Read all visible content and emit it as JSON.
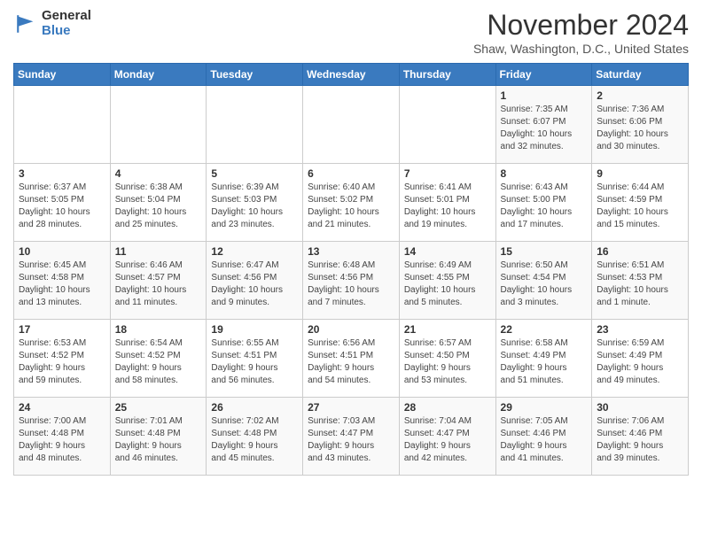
{
  "logo": {
    "general": "General",
    "blue": "Blue"
  },
  "header": {
    "month": "November 2024",
    "location": "Shaw, Washington, D.C., United States"
  },
  "days_of_week": [
    "Sunday",
    "Monday",
    "Tuesday",
    "Wednesday",
    "Thursday",
    "Friday",
    "Saturday"
  ],
  "weeks": [
    [
      {
        "day": "",
        "info": ""
      },
      {
        "day": "",
        "info": ""
      },
      {
        "day": "",
        "info": ""
      },
      {
        "day": "",
        "info": ""
      },
      {
        "day": "",
        "info": ""
      },
      {
        "day": "1",
        "info": "Sunrise: 7:35 AM\nSunset: 6:07 PM\nDaylight: 10 hours\nand 32 minutes."
      },
      {
        "day": "2",
        "info": "Sunrise: 7:36 AM\nSunset: 6:06 PM\nDaylight: 10 hours\nand 30 minutes."
      }
    ],
    [
      {
        "day": "3",
        "info": "Sunrise: 6:37 AM\nSunset: 5:05 PM\nDaylight: 10 hours\nand 28 minutes."
      },
      {
        "day": "4",
        "info": "Sunrise: 6:38 AM\nSunset: 5:04 PM\nDaylight: 10 hours\nand 25 minutes."
      },
      {
        "day": "5",
        "info": "Sunrise: 6:39 AM\nSunset: 5:03 PM\nDaylight: 10 hours\nand 23 minutes."
      },
      {
        "day": "6",
        "info": "Sunrise: 6:40 AM\nSunset: 5:02 PM\nDaylight: 10 hours\nand 21 minutes."
      },
      {
        "day": "7",
        "info": "Sunrise: 6:41 AM\nSunset: 5:01 PM\nDaylight: 10 hours\nand 19 minutes."
      },
      {
        "day": "8",
        "info": "Sunrise: 6:43 AM\nSunset: 5:00 PM\nDaylight: 10 hours\nand 17 minutes."
      },
      {
        "day": "9",
        "info": "Sunrise: 6:44 AM\nSunset: 4:59 PM\nDaylight: 10 hours\nand 15 minutes."
      }
    ],
    [
      {
        "day": "10",
        "info": "Sunrise: 6:45 AM\nSunset: 4:58 PM\nDaylight: 10 hours\nand 13 minutes."
      },
      {
        "day": "11",
        "info": "Sunrise: 6:46 AM\nSunset: 4:57 PM\nDaylight: 10 hours\nand 11 minutes."
      },
      {
        "day": "12",
        "info": "Sunrise: 6:47 AM\nSunset: 4:56 PM\nDaylight: 10 hours\nand 9 minutes."
      },
      {
        "day": "13",
        "info": "Sunrise: 6:48 AM\nSunset: 4:56 PM\nDaylight: 10 hours\nand 7 minutes."
      },
      {
        "day": "14",
        "info": "Sunrise: 6:49 AM\nSunset: 4:55 PM\nDaylight: 10 hours\nand 5 minutes."
      },
      {
        "day": "15",
        "info": "Sunrise: 6:50 AM\nSunset: 4:54 PM\nDaylight: 10 hours\nand 3 minutes."
      },
      {
        "day": "16",
        "info": "Sunrise: 6:51 AM\nSunset: 4:53 PM\nDaylight: 10 hours\nand 1 minute."
      }
    ],
    [
      {
        "day": "17",
        "info": "Sunrise: 6:53 AM\nSunset: 4:52 PM\nDaylight: 9 hours\nand 59 minutes."
      },
      {
        "day": "18",
        "info": "Sunrise: 6:54 AM\nSunset: 4:52 PM\nDaylight: 9 hours\nand 58 minutes."
      },
      {
        "day": "19",
        "info": "Sunrise: 6:55 AM\nSunset: 4:51 PM\nDaylight: 9 hours\nand 56 minutes."
      },
      {
        "day": "20",
        "info": "Sunrise: 6:56 AM\nSunset: 4:51 PM\nDaylight: 9 hours\nand 54 minutes."
      },
      {
        "day": "21",
        "info": "Sunrise: 6:57 AM\nSunset: 4:50 PM\nDaylight: 9 hours\nand 53 minutes."
      },
      {
        "day": "22",
        "info": "Sunrise: 6:58 AM\nSunset: 4:49 PM\nDaylight: 9 hours\nand 51 minutes."
      },
      {
        "day": "23",
        "info": "Sunrise: 6:59 AM\nSunset: 4:49 PM\nDaylight: 9 hours\nand 49 minutes."
      }
    ],
    [
      {
        "day": "24",
        "info": "Sunrise: 7:00 AM\nSunset: 4:48 PM\nDaylight: 9 hours\nand 48 minutes."
      },
      {
        "day": "25",
        "info": "Sunrise: 7:01 AM\nSunset: 4:48 PM\nDaylight: 9 hours\nand 46 minutes."
      },
      {
        "day": "26",
        "info": "Sunrise: 7:02 AM\nSunset: 4:48 PM\nDaylight: 9 hours\nand 45 minutes."
      },
      {
        "day": "27",
        "info": "Sunrise: 7:03 AM\nSunset: 4:47 PM\nDaylight: 9 hours\nand 43 minutes."
      },
      {
        "day": "28",
        "info": "Sunrise: 7:04 AM\nSunset: 4:47 PM\nDaylight: 9 hours\nand 42 minutes."
      },
      {
        "day": "29",
        "info": "Sunrise: 7:05 AM\nSunset: 4:46 PM\nDaylight: 9 hours\nand 41 minutes."
      },
      {
        "day": "30",
        "info": "Sunrise: 7:06 AM\nSunset: 4:46 PM\nDaylight: 9 hours\nand 39 minutes."
      }
    ]
  ]
}
